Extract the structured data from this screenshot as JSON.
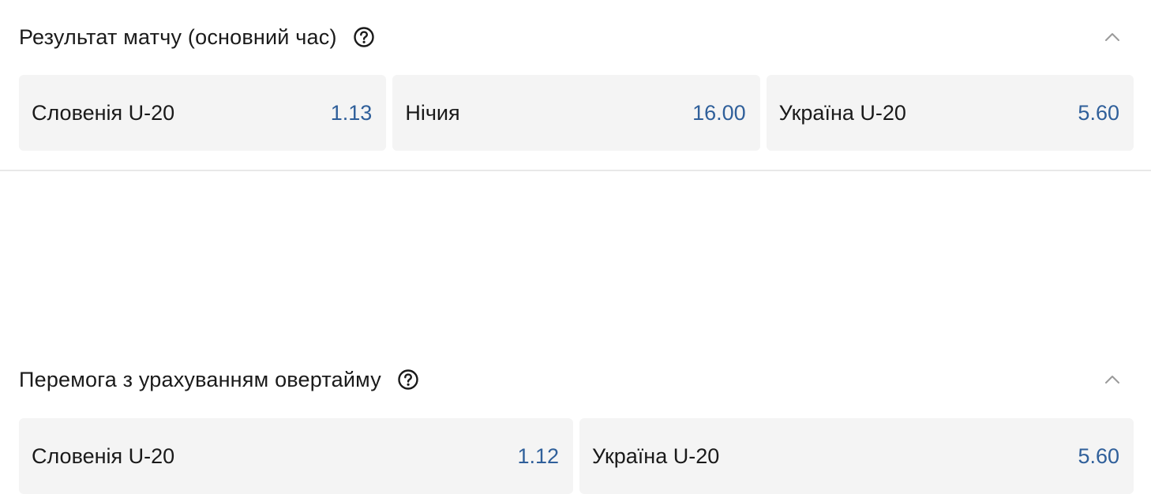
{
  "markets": [
    {
      "title": "Результат матчу (основний час)",
      "help_icon": "question-circle-icon",
      "collapse_icon": "chevron-up-icon",
      "outcomes": [
        {
          "label": "Словенія U-20",
          "odds": "1.13"
        },
        {
          "label": "Нічия",
          "odds": "16.00"
        },
        {
          "label": "Україна U-20",
          "odds": "5.60"
        }
      ]
    },
    {
      "title": "Перемога з урахуванням овертайму",
      "help_icon": "question-circle-icon",
      "collapse_icon": "chevron-up-icon",
      "outcomes": [
        {
          "label": "Словенія U-20",
          "odds": "1.12"
        },
        {
          "label": "Україна U-20",
          "odds": "5.60"
        }
      ]
    }
  ],
  "colors": {
    "odds": "#2f5f9a",
    "tile_background": "#f4f4f4",
    "divider": "#e8e8e8",
    "text": "#1a1a1a"
  }
}
